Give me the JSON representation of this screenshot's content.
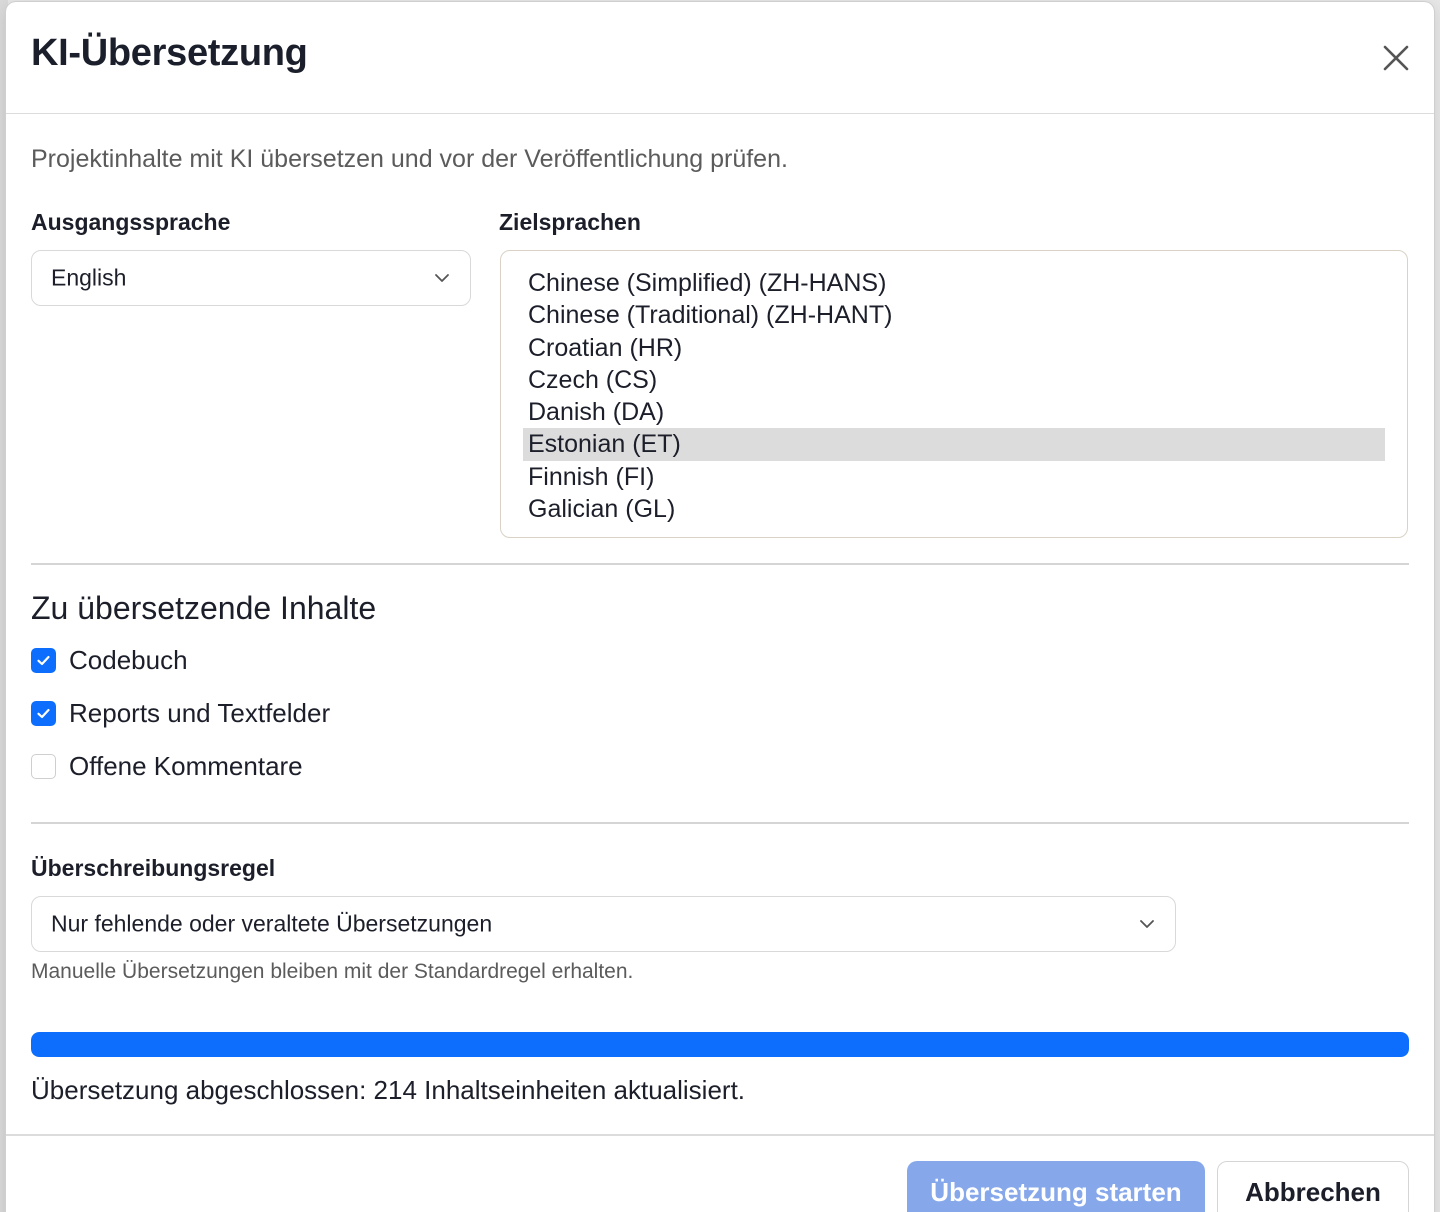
{
  "dialog": {
    "title": "KI-Übersetzung",
    "subtitle": "Projektinhalte mit KI übersetzen und vor der Veröffentlichung prüfen."
  },
  "source_language": {
    "label": "Ausgangssprache",
    "value": "English"
  },
  "target_languages": {
    "label": "Zielsprachen",
    "items": [
      {
        "label": "Chinese (Simplified) (ZH-HANS)",
        "selected": false
      },
      {
        "label": "Chinese (Traditional) (ZH-HANT)",
        "selected": false
      },
      {
        "label": "Croatian (HR)",
        "selected": false
      },
      {
        "label": "Czech (CS)",
        "selected": false
      },
      {
        "label": "Danish (DA)",
        "selected": false
      },
      {
        "label": "Estonian (ET)",
        "selected": true
      },
      {
        "label": "Finnish (FI)",
        "selected": false
      },
      {
        "label": "Galician (GL)",
        "selected": false
      }
    ]
  },
  "content_section": {
    "title": "Zu übersetzende Inhalte",
    "options": [
      {
        "label": "Codebuch",
        "checked": true
      },
      {
        "label": "Reports und Textfelder",
        "checked": true
      },
      {
        "label": "Offene Kommentare",
        "checked": false
      }
    ]
  },
  "overwrite_rule": {
    "label": "Überschreibungsregel",
    "value": "Nur fehlende oder veraltete Übersetzungen",
    "help": "Manuelle Übersetzungen bleiben mit der Standardregel erhalten."
  },
  "progress": {
    "percent": 100,
    "status": "Übersetzung abgeschlossen: 214 Inhaltseinheiten aktualisiert."
  },
  "buttons": {
    "start": "Übersetzung starten",
    "cancel": "Abbrechen"
  },
  "colors": {
    "accent": "#0d6efd",
    "primary_button_disabled": "#86a8ea",
    "selected_item_bg": "#dcdcdc"
  }
}
